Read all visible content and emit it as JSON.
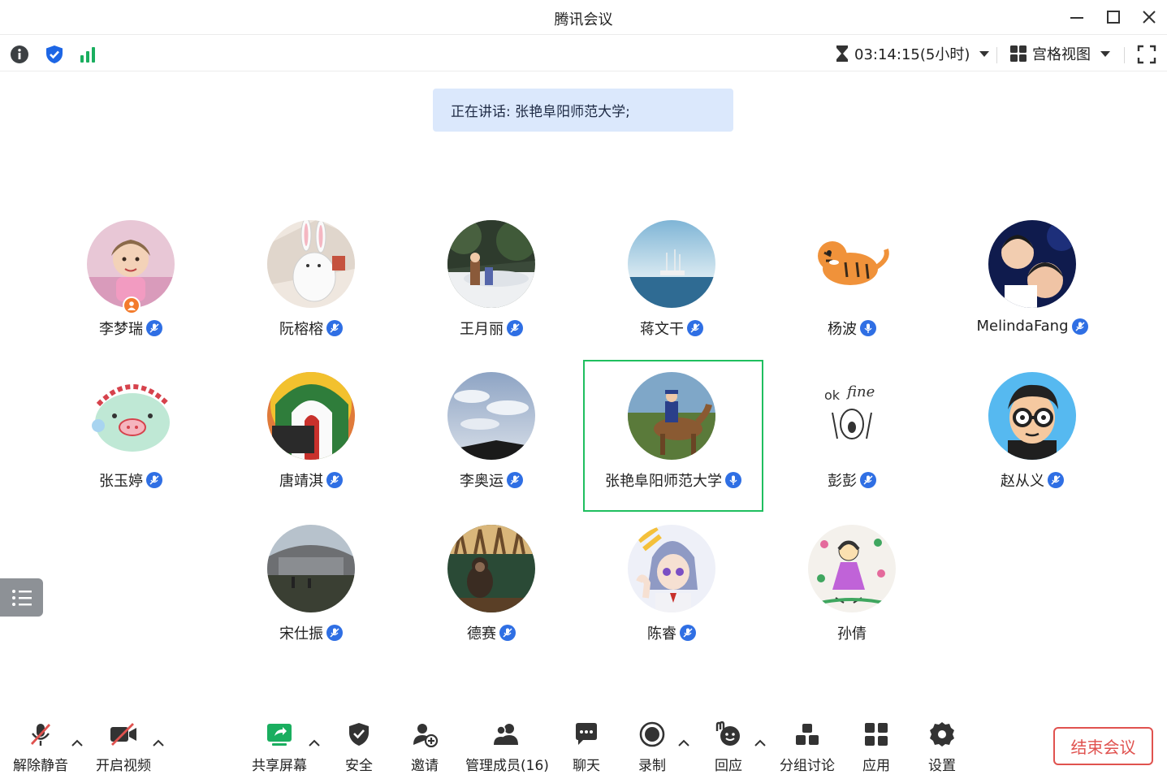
{
  "window": {
    "title": "腾讯会议"
  },
  "topbar": {
    "timer": "03:14:15(5小时)",
    "view_mode": "宫格视图"
  },
  "speaking": "正在讲话: 张艳阜阳师范大学;",
  "participants": [
    {
      "name": "李梦瑞",
      "mic": "muted",
      "host": true
    },
    {
      "name": "阮榕榕",
      "mic": "muted"
    },
    {
      "name": "王月丽",
      "mic": "muted"
    },
    {
      "name": "蒋文干",
      "mic": "muted"
    },
    {
      "name": "杨波",
      "mic": "on"
    },
    {
      "name": "MelindaFang",
      "mic": "muted"
    },
    {
      "name": "张玉婷",
      "mic": "muted"
    },
    {
      "name": "唐靖淇",
      "mic": "muted"
    },
    {
      "name": "李奥运",
      "mic": "muted"
    },
    {
      "name": "张艳阜阳师范大学",
      "mic": "on",
      "active": true
    },
    {
      "name": "彭彭",
      "mic": "muted"
    },
    {
      "name": "赵从义",
      "mic": "muted"
    },
    {
      "name": "宋仕振",
      "mic": "muted"
    },
    {
      "name": "德赛",
      "mic": "muted"
    },
    {
      "name": "陈睿",
      "mic": "muted"
    },
    {
      "name": "孙倩",
      "mic": "none"
    }
  ],
  "toolbar": {
    "unmute": "解除静音",
    "start_video": "开启视频",
    "share_screen": "共享屏幕",
    "security": "安全",
    "invite": "邀请",
    "members": "管理成员(16)",
    "chat": "聊天",
    "record": "录制",
    "react": "回应",
    "breakout": "分组讨论",
    "apps": "应用",
    "settings": "设置",
    "end_meeting": "结束会议"
  },
  "colors": {
    "accent_blue": "#2f6fe4",
    "active_border": "#1fbf5f",
    "end_red": "#e0524f",
    "share_green": "#1aae5f"
  }
}
